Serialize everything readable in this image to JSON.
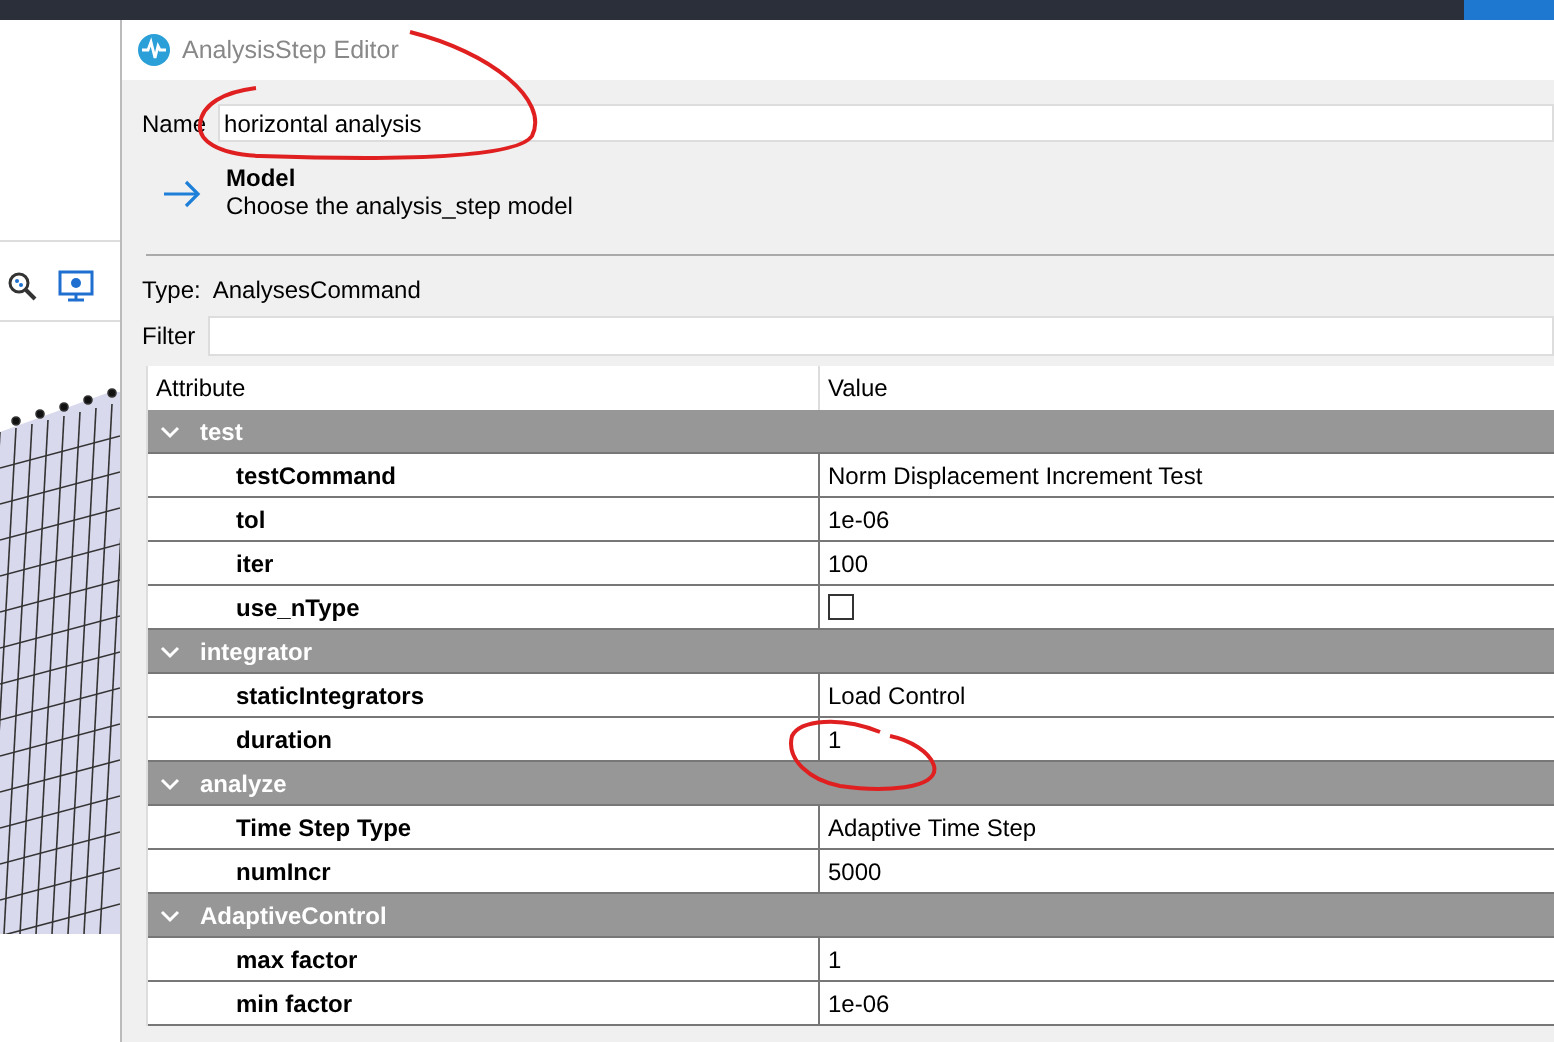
{
  "window": {
    "title": "AnalysisStep Editor"
  },
  "name_field": {
    "label": "Name",
    "value": "horizontal analysis"
  },
  "model": {
    "title": "Model",
    "description": "Choose the analysis_step model"
  },
  "type": {
    "label": "Type:",
    "value": "AnalysesCommand"
  },
  "filter": {
    "label": "Filter"
  },
  "table": {
    "columns": [
      "Attribute",
      "Value"
    ],
    "groups": [
      {
        "name": "test",
        "expanded": true,
        "rows": [
          {
            "attribute": "testCommand",
            "kind": "text",
            "value": "Norm Displacement Increment Test"
          },
          {
            "attribute": "tol",
            "kind": "text",
            "value": "1e-06"
          },
          {
            "attribute": "iter",
            "kind": "text",
            "value": "100"
          },
          {
            "attribute": "use_nType",
            "kind": "checkbox",
            "checked": false
          }
        ]
      },
      {
        "name": "integrator",
        "expanded": true,
        "rows": [
          {
            "attribute": "staticIntegrators",
            "kind": "text",
            "value": "Load Control"
          },
          {
            "attribute": "duration",
            "kind": "text",
            "value": "1"
          }
        ]
      },
      {
        "name": "analyze",
        "expanded": true,
        "rows": [
          {
            "attribute": "Time Step Type",
            "kind": "text",
            "value": "Adaptive Time Step"
          },
          {
            "attribute": "numIncr",
            "kind": "text",
            "value": "5000"
          }
        ]
      },
      {
        "name": "AdaptiveControl",
        "expanded": true,
        "rows": [
          {
            "attribute": "max factor",
            "kind": "text",
            "value": "1"
          },
          {
            "attribute": "min factor",
            "kind": "text",
            "value": "1e-06"
          }
        ]
      }
    ]
  }
}
